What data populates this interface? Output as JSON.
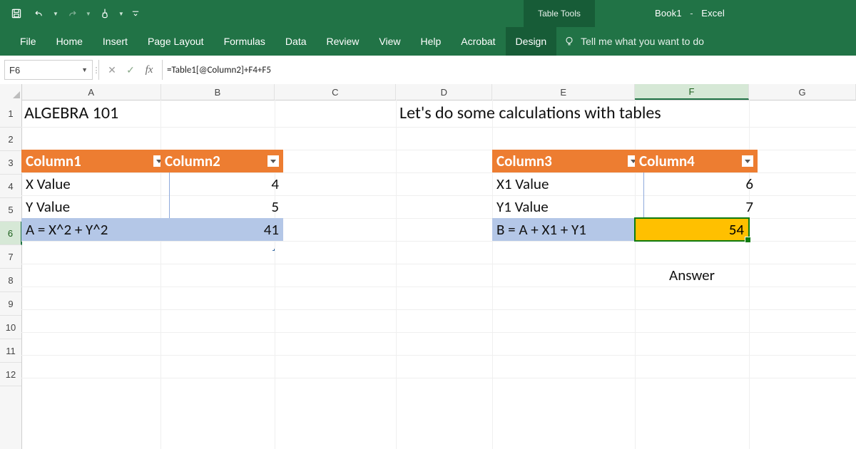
{
  "title": {
    "doc": "Book1",
    "app": "Excel",
    "table_tools": "Table Tools"
  },
  "qat": {
    "save": "save-icon",
    "undo": "undo-icon",
    "redo": "redo-icon",
    "touch": "touch-mode-icon",
    "custom": "customize-icon"
  },
  "ribbon": {
    "tabs": [
      "File",
      "Home",
      "Insert",
      "Page Layout",
      "Formulas",
      "Data",
      "Review",
      "View",
      "Help",
      "Acrobat",
      "Design"
    ],
    "active": "Design",
    "tellme": "Tell me what you want to do"
  },
  "formula": {
    "namebox": "F6",
    "text": "=Table1[@Column2]+F4+F5"
  },
  "columns": [
    "A",
    "B",
    "C",
    "D",
    "E",
    "F",
    "G"
  ],
  "rows": [
    "1",
    "2",
    "3",
    "4",
    "5",
    "6",
    "7",
    "8",
    "9",
    "10",
    "11",
    "12"
  ],
  "active_cell": {
    "col": "F",
    "row": "6"
  },
  "content": {
    "A1": "ALGEBRA 101",
    "D1": "Let's do some calculations with tables",
    "table1": {
      "headers": [
        "Column1",
        "Column2"
      ],
      "rows": [
        {
          "label": "X Value",
          "value": "4"
        },
        {
          "label": "Y Value",
          "value": "5"
        },
        {
          "label": "A = X^2 + Y^2",
          "value": "41"
        }
      ]
    },
    "table2": {
      "headers": [
        "Column3",
        "Column4"
      ],
      "rows": [
        {
          "label": "X1 Value",
          "value": "6"
        },
        {
          "label": "Y1 Value",
          "value": "7"
        },
        {
          "label": "B = A + X1 + Y1",
          "value": "54"
        }
      ]
    },
    "F8": "Answer"
  }
}
